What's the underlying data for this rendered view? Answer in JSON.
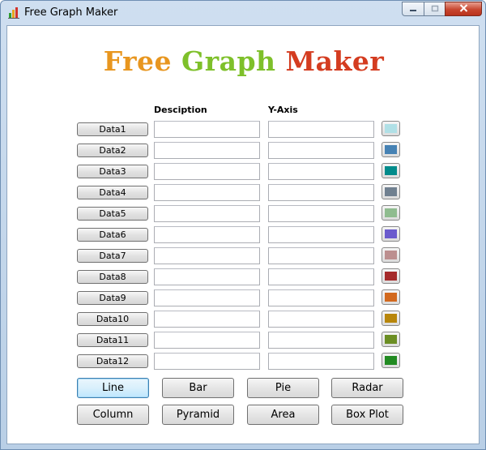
{
  "window": {
    "title": "Free Graph Maker"
  },
  "header": {
    "word1": "Free",
    "word2": "Graph",
    "word3": "Maker"
  },
  "columns": {
    "description": "Desciption",
    "yaxis": "Y-Axis"
  },
  "rows": [
    {
      "label": "Data1",
      "description": "",
      "y": "",
      "color": "#b0e0e6"
    },
    {
      "label": "Data2",
      "description": "",
      "y": "",
      "color": "#4682b4"
    },
    {
      "label": "Data3",
      "description": "",
      "y": "",
      "color": "#008b8b"
    },
    {
      "label": "Data4",
      "description": "",
      "y": "",
      "color": "#708090"
    },
    {
      "label": "Data5",
      "description": "",
      "y": "",
      "color": "#8fbc8f"
    },
    {
      "label": "Data6",
      "description": "",
      "y": "",
      "color": "#6a5acd"
    },
    {
      "label": "Data7",
      "description": "",
      "y": "",
      "color": "#bc8f8f"
    },
    {
      "label": "Data8",
      "description": "",
      "y": "",
      "color": "#a52a2a"
    },
    {
      "label": "Data9",
      "description": "",
      "y": "",
      "color": "#d2691e"
    },
    {
      "label": "Data10",
      "description": "",
      "y": "",
      "color": "#b8860b"
    },
    {
      "label": "Data11",
      "description": "",
      "y": "",
      "color": "#6b8e23"
    },
    {
      "label": "Data12",
      "description": "",
      "y": "",
      "color": "#228b22"
    }
  ],
  "chart_buttons": {
    "line": "Line",
    "bar": "Bar",
    "pie": "Pie",
    "radar": "Radar",
    "column": "Column",
    "pyramid": "Pyramid",
    "area": "Area",
    "boxplot": "Box Plot"
  },
  "icons": {
    "app": "bar-chart-icon",
    "minimize": "minimize-icon",
    "maximize": "maximize-icon",
    "close": "close-icon"
  }
}
